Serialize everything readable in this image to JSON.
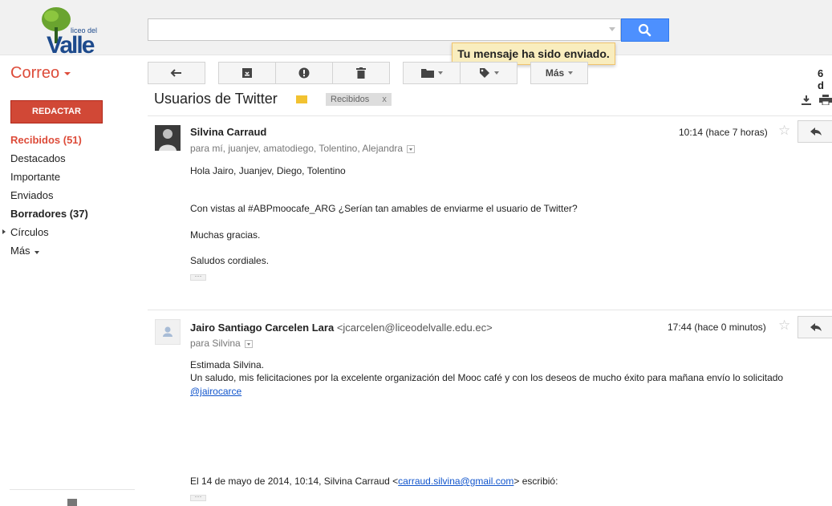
{
  "header": {
    "logo_text_top": "liceo del",
    "logo_text_main": "Valle",
    "search_placeholder": "",
    "toast": "Tu mensaje ha sido enviado."
  },
  "toolbar": {
    "app_label": "Correo",
    "more_label": "Más",
    "page_count": "6 d"
  },
  "sidebar": {
    "compose_label": "REDACTAR",
    "items": [
      {
        "label": "Recibidos (51)"
      },
      {
        "label": "Destacados"
      },
      {
        "label": "Importante"
      },
      {
        "label": "Enviados"
      },
      {
        "label": "Borradores (37)"
      },
      {
        "label": "Círculos"
      },
      {
        "label": "Más"
      }
    ]
  },
  "conversation": {
    "subject": "Usuarios de Twitter",
    "label_chip": "Recibidos",
    "label_chip_close": "x"
  },
  "messages": [
    {
      "from_name": "Silvina Carraud",
      "from_email": "",
      "to_line": "para mí, juanjev, amatodiego, Tolentino, Alejandra",
      "timestamp": "10:14 (hace 7 horas)",
      "body": [
        "Hola Jairo, Juanjev, Diego, Tolentino",
        "Con vistas al #ABPmoocafe_ARG ¿Serían tan amables de enviarme el usuario de Twitter?",
        "Muchas gracias.",
        "Saludos cordiales."
      ],
      "ellipsis": "···"
    },
    {
      "from_name": "Jairo Santiago Carcelen Lara",
      "from_email": "<jcarcelen@liceodelvalle.edu.ec>",
      "to_line": "para Silvina",
      "timestamp": "17:44 (hace 0 minutos)",
      "body": [
        "Estimada Silvina.",
        "Un saludo, mis felicitaciones por la excelente organización del Mooc café y con los deseos de mucho éxito para mañana envío lo solicitado",
        "@jairocarce"
      ],
      "quote_prefix": "El 14 de mayo de 2014, 10:14, Silvina Carraud <",
      "quote_email": "carraud.silvina@gmail.com",
      "quote_suffix": "> escribió:",
      "ellipsis": "···"
    }
  ]
}
